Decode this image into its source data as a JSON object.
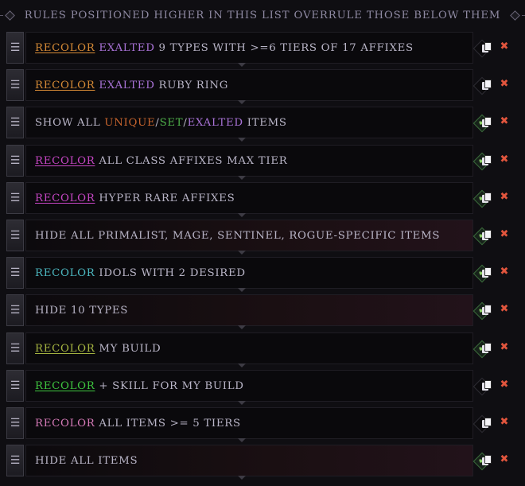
{
  "header": {
    "title": "Rules positioned higher in this list overrule those below them"
  },
  "colors": {
    "orange": "#d58a36",
    "purple": "#a872d6",
    "unique_orange": "#c8652e",
    "set_green": "#4fb04a",
    "magenta": "#c646c4",
    "cyan": "#4cb8c1",
    "olive": "#a5b441",
    "green": "#3ec53f",
    "pink": "#d67ab8",
    "text": "#b9b5c7"
  },
  "icons": {
    "handle": "drag-handle-icon",
    "toggle": "checkmark-diamond-icon",
    "copy": "copy-icon",
    "delete": "close-icon"
  },
  "rules": [
    {
      "segments": [
        {
          "text": "Recolor",
          "color": "#d58a36",
          "underline": true
        },
        {
          "text": " "
        },
        {
          "text": "Exalted",
          "color": "#a872d6"
        },
        {
          "text": " 9 types with >=6 tiers of 17 affixes"
        }
      ],
      "enabled": false,
      "red": false
    },
    {
      "segments": [
        {
          "text": "Recolor",
          "color": "#d58a36",
          "underline": true
        },
        {
          "text": " "
        },
        {
          "text": "Exalted",
          "color": "#a872d6"
        },
        {
          "text": " ruby ring"
        }
      ],
      "enabled": false,
      "red": false
    },
    {
      "segments": [
        {
          "text": "Show all "
        },
        {
          "text": "Unique",
          "color": "#c8652e"
        },
        {
          "text": "/"
        },
        {
          "text": "Set",
          "color": "#4fb04a"
        },
        {
          "text": "/"
        },
        {
          "text": "Exalted",
          "color": "#a872d6"
        },
        {
          "text": " items"
        }
      ],
      "enabled": true,
      "red": false
    },
    {
      "segments": [
        {
          "text": "Recolor",
          "color": "#c646c4",
          "underline": true
        },
        {
          "text": " all class affixes max tier"
        }
      ],
      "enabled": true,
      "red": false
    },
    {
      "segments": [
        {
          "text": "Recolor",
          "color": "#c646c4",
          "underline": true
        },
        {
          "text": " hyper rare affixes"
        }
      ],
      "enabled": true,
      "red": false
    },
    {
      "segments": [
        {
          "text": "Hide all Primalist, Mage, Sentinel, Rogue-specific items"
        }
      ],
      "enabled": true,
      "red": true
    },
    {
      "segments": [
        {
          "text": "Recolor",
          "color": "#4cb8c1"
        },
        {
          "text": " idols with 2 desired"
        }
      ],
      "enabled": true,
      "red": false
    },
    {
      "segments": [
        {
          "text": "Hide 10 types"
        }
      ],
      "enabled": true,
      "red": true
    },
    {
      "segments": [
        {
          "text": "Recolor",
          "color": "#a5b441",
          "underline": true
        },
        {
          "text": " my build"
        }
      ],
      "enabled": true,
      "red": false
    },
    {
      "segments": [
        {
          "text": "Recolor",
          "color": "#3ec53f",
          "underline": true
        },
        {
          "text": " + skill for my build"
        }
      ],
      "enabled": false,
      "red": false
    },
    {
      "segments": [
        {
          "text": "Recolor",
          "color": "#d67ab8"
        },
        {
          "text": " all items >= 5 tiers"
        }
      ],
      "enabled": false,
      "red": false
    },
    {
      "segments": [
        {
          "text": "Hide all items"
        }
      ],
      "enabled": true,
      "red": true
    }
  ]
}
